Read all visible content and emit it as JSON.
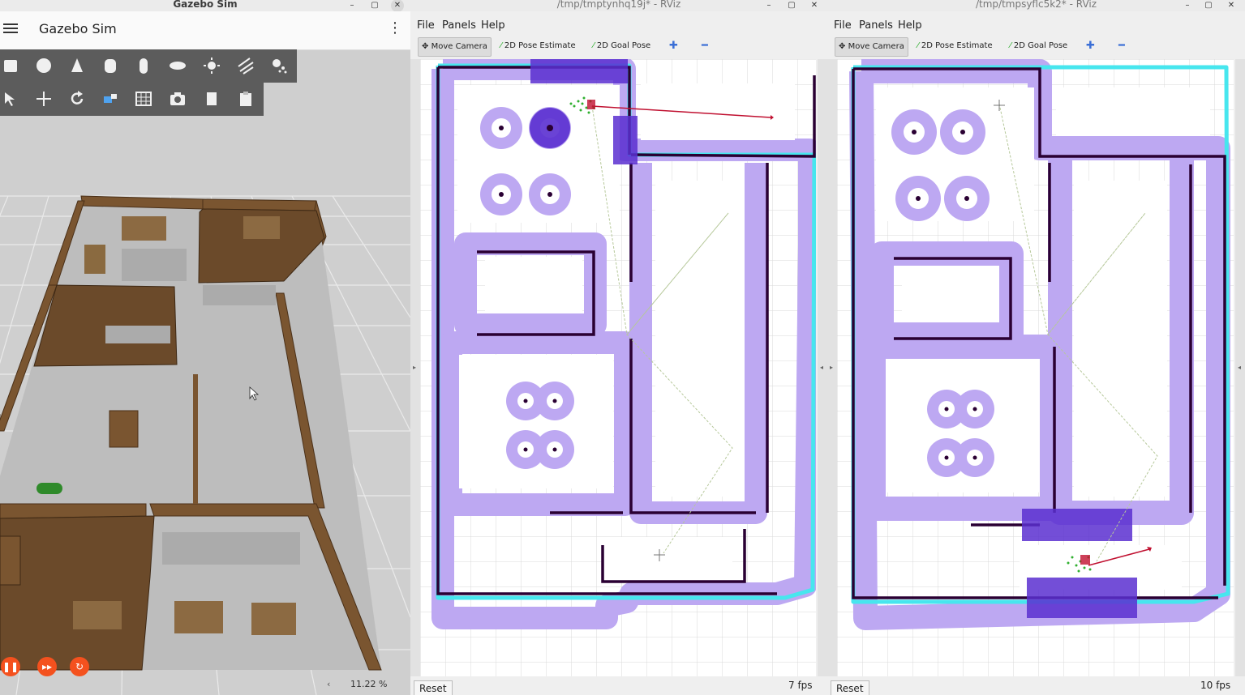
{
  "gazebo": {
    "window_title": "Gazebo Sim",
    "app_title": "Gazebo Sim",
    "rtf": "11.22 %",
    "rtf_arrow": "‹",
    "colors": {
      "play": "#f4511e",
      "toolbar": "#5c5c5c"
    },
    "shape_tools": [
      "box-icon",
      "sphere-icon",
      "cone-icon",
      "cylinder-icon",
      "capsule-icon",
      "ellipsoid-icon",
      "sun-light-icon",
      "directional-light-icon",
      "spot-light-icon"
    ],
    "transform_tools": [
      "select-arrow-icon",
      "translate-icon",
      "rotate-icon",
      "snap-icon",
      "grid-icon",
      "camera-icon",
      "copy-icon",
      "paste-icon"
    ]
  },
  "rviz_left": {
    "window_title": "/tmp/tmptynhq19j* - RViz",
    "menu": [
      "File",
      "Panels",
      "Help"
    ],
    "tools": [
      "Move Camera",
      "2D Pose Estimate",
      "2D Goal Pose"
    ],
    "reset": "Reset",
    "fps": "7 fps"
  },
  "rviz_right": {
    "window_title": "/tmp/tmpsyflc5k2* - RViz",
    "menu": [
      "File",
      "Panels",
      "Help"
    ],
    "tools": [
      "Move Camera",
      "2D Pose Estimate",
      "2D Goal Pose"
    ],
    "reset": "Reset",
    "fps": "10 fps"
  },
  "map_colors": {
    "inflation": "#b9a6f0",
    "cost": "#45e6ee",
    "wall": "#2a0033",
    "free": "#ffffff",
    "grid": "#d4d4d4",
    "robot_plan": "#c01030",
    "particles": "#2fb02f"
  }
}
